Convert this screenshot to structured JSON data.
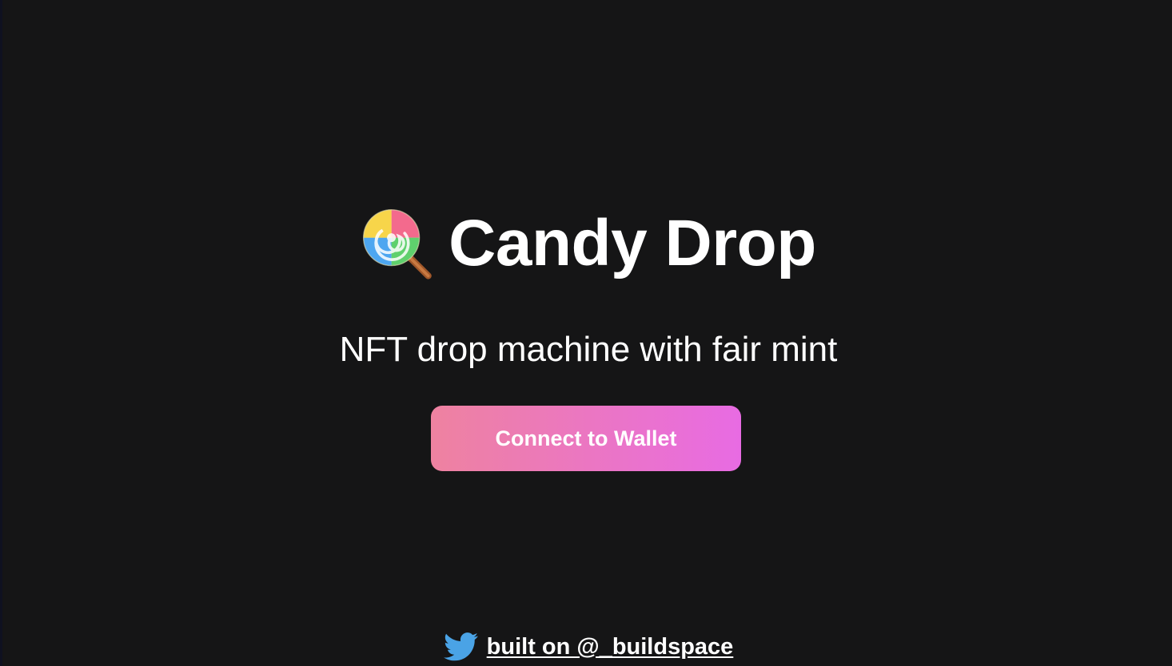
{
  "header": {
    "icon": "lollipop-icon",
    "title": "Candy Drop"
  },
  "main": {
    "subtitle": "NFT drop machine with fair mint",
    "connect_button_label": "Connect to Wallet"
  },
  "footer": {
    "icon": "twitter-icon",
    "link_text": "built on @_buildspace"
  },
  "colors": {
    "background": "#151516",
    "text": "#ffffff",
    "button_gradient_start": "#ee82a0",
    "button_gradient_end": "#e86be3",
    "twitter_blue": "#4aa3e6"
  }
}
